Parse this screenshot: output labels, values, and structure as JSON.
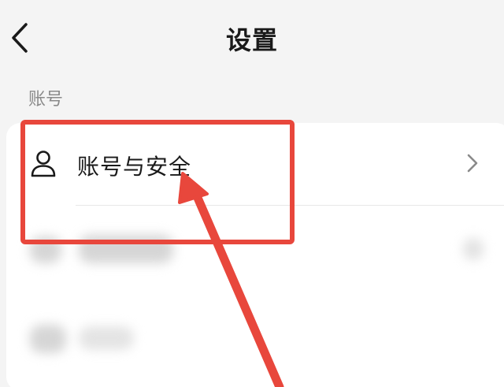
{
  "header": {
    "title": "设置",
    "back_icon": "chevron-left-icon"
  },
  "account_section": {
    "label": "账号",
    "items": [
      {
        "label": "账号与安全",
        "icon": "user-icon",
        "trailing_icon": "chevron-right-icon"
      }
    ]
  },
  "annotation": {
    "color": "#e8473c",
    "type": "highlight-box-with-arrow"
  }
}
